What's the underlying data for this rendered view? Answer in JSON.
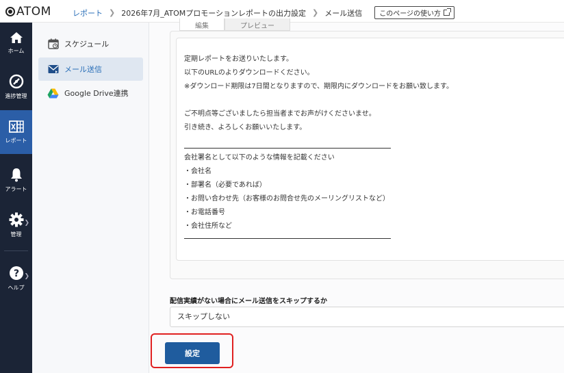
{
  "header": {
    "logo": "ATOM",
    "breadcrumb": {
      "report": "レポート",
      "report_name": "2026年7月_ATOMプロモーションレポートの出力設定",
      "current": "メール送信"
    },
    "help_label": "このページの使い方"
  },
  "leftnav": {
    "items": [
      {
        "label": "ホーム",
        "icon": "home-icon"
      },
      {
        "label": "進捗管理",
        "icon": "progress-icon"
      },
      {
        "label": "レポート",
        "icon": "report-icon"
      },
      {
        "label": "アラート",
        "icon": "bell-icon"
      },
      {
        "label": "管理",
        "icon": "gear-icon"
      },
      {
        "label": "ヘルプ",
        "icon": "help-icon"
      }
    ]
  },
  "subnav": {
    "items": [
      {
        "label": "スケジュール",
        "icon": "calendar-icon"
      },
      {
        "label": "メール送信",
        "icon": "mail-icon"
      },
      {
        "label": "Google Drive連携",
        "icon": "google-drive-icon"
      }
    ]
  },
  "tabs": [
    "編集",
    "プレビュー"
  ],
  "email_body": {
    "lines": [
      "定期レポートをお送りいたします。",
      "以下のURLのよりダウンロードください。",
      "※ダウンロード期限は7日間となりますので、期限内にダウンロードをお願い致します。",
      "",
      "ご不明点等ございましたら担当者までお声がけくださいませ。",
      "引き続き、よろしくお願いいたします。"
    ],
    "signature_lines": [
      "会社署名として以下のような情報を記載ください",
      "・会社名",
      "・部署名（必要であれば）",
      "・お問い合わせ先（お客様のお問合せ先のメーリングリストなど）",
      "・お電話番号",
      "・会社住所など"
    ]
  },
  "skip": {
    "label": "配信実績がない場合にメール送信をスキップするか",
    "value": "スキップしない"
  },
  "submit_label": "設定",
  "colors": {
    "nav_bg": "#1b2436",
    "nav_active": "#2b5ea7",
    "primary_button": "#1f5c9e",
    "highlight": "#e02020"
  }
}
